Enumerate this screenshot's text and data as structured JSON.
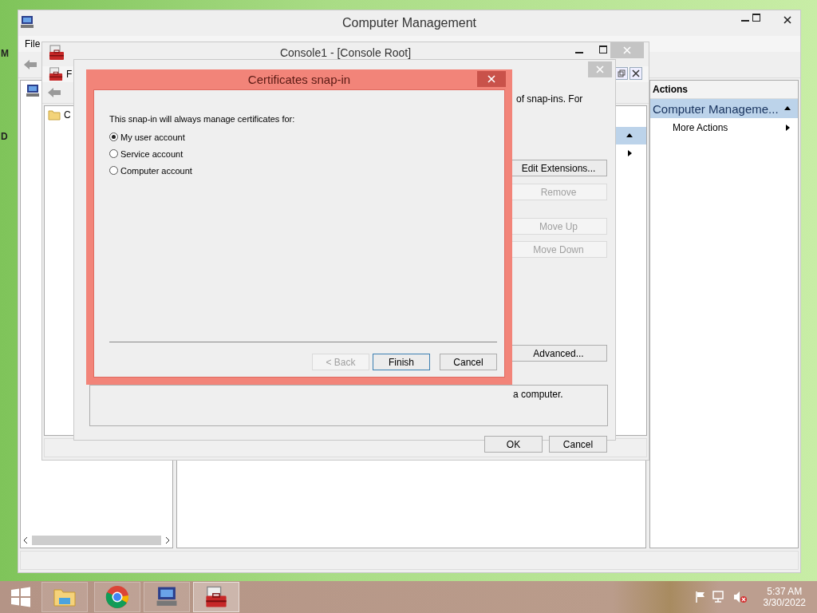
{
  "desktop": {
    "icon_labels": [
      "M",
      "D"
    ]
  },
  "main_window": {
    "title": "Computer Management",
    "menu": [
      "File"
    ],
    "actions_pane": {
      "header": "Actions",
      "items": [
        {
          "label": "Computer Manageme...",
          "kind": "section",
          "expanded": true
        },
        {
          "label": "More Actions",
          "kind": "submenu"
        }
      ]
    }
  },
  "console_window": {
    "title": "Console1 - [Console Root]",
    "menu": [
      "F"
    ],
    "tree": [
      {
        "label": "C"
      }
    ]
  },
  "snapins_dialog": {
    "intro": "of snap-ins. For",
    "buttons": [
      {
        "label": "Edit Extensions...",
        "disabled": false
      },
      {
        "label": "Remove",
        "disabled": true
      },
      {
        "label": "Move Up",
        "disabled": true
      },
      {
        "label": "Move Down",
        "disabled": true
      },
      {
        "label": "Advanced...",
        "disabled": false
      }
    ],
    "description": "a computer.",
    "footer_buttons": [
      "OK",
      "Cancel"
    ]
  },
  "cert_dialog": {
    "title": "Certificates snap-in",
    "prompt": "This snap-in will always manage certificates for:",
    "options": [
      {
        "label": "My user account",
        "selected": true
      },
      {
        "label": "Service account",
        "selected": false
      },
      {
        "label": "Computer account",
        "selected": false
      }
    ],
    "buttons": [
      {
        "label": "< Back",
        "disabled": true,
        "focused": false
      },
      {
        "label": "Finish",
        "disabled": false,
        "focused": true
      },
      {
        "label": "Cancel",
        "disabled": false,
        "focused": false
      }
    ]
  },
  "taskbar": {
    "apps": [
      {
        "kind": "explorer",
        "active": false
      },
      {
        "kind": "chrome",
        "active": false
      },
      {
        "kind": "computer",
        "active": false
      },
      {
        "kind": "toolbox",
        "active": true
      }
    ],
    "time": "5:37 AM",
    "date": "3/30/2022"
  }
}
